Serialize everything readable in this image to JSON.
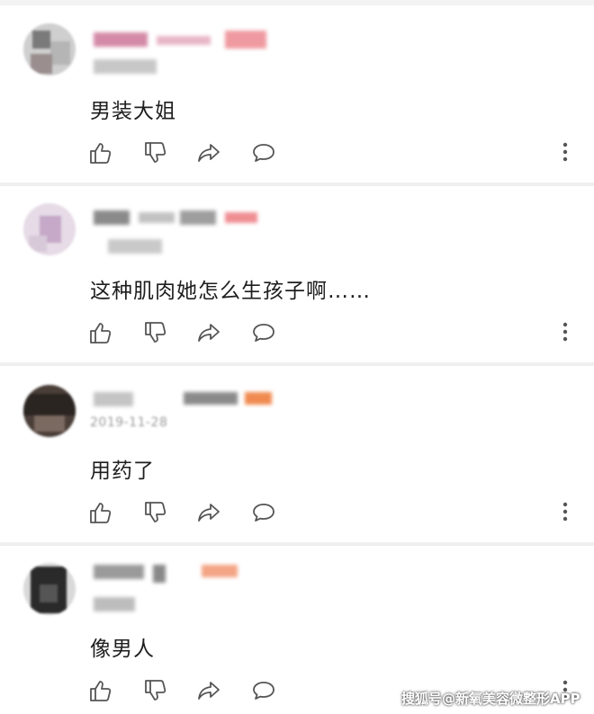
{
  "comments": [
    {
      "text": "男装大姐",
      "date": ""
    },
    {
      "text": "这种肌肉她怎么生孩子啊……",
      "date": ""
    },
    {
      "text": "用药了",
      "date": "2019-11-28"
    },
    {
      "text": "像男人",
      "date": ""
    }
  ],
  "actions": {
    "like_icon": "thumbs-up-icon",
    "dislike_icon": "thumbs-down-icon",
    "share_icon": "share-icon",
    "reply_icon": "comment-bubble-icon",
    "more_icon": "more-vertical-icon"
  },
  "watermark": "搜狐号@新氧美容微整形APP",
  "colors": {
    "icon": "#555555",
    "divider": "#efefef",
    "text": "#1e1e1e"
  }
}
